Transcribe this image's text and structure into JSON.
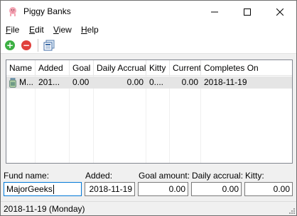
{
  "window": {
    "title": "Piggy Banks",
    "icon": "piggy-bank-icon",
    "controls": [
      "minimize-icon",
      "maximize-icon",
      "close-icon"
    ]
  },
  "menu": [
    {
      "label_first": "F",
      "label_rest": "ile"
    },
    {
      "label_first": "E",
      "label_rest": "dit"
    },
    {
      "label_first": "V",
      "label_rest": "iew"
    },
    {
      "label_first": "H",
      "label_rest": "elp"
    }
  ],
  "toolbar": {
    "add_icon": "add-icon",
    "remove_icon": "remove-icon",
    "report_icon": "report-icon",
    "add_color": "#3cb043",
    "remove_color": "#e0403c"
  },
  "list": {
    "columns": [
      "Name",
      "Added",
      "Goal",
      "Daily Accrual",
      "Kitty",
      "Current",
      "Completes On"
    ],
    "rows": [
      {
        "icon": "jar-icon",
        "name": "M...",
        "added": "201...",
        "goal": "0.00",
        "daily_accrual": "0.00",
        "kitty": "0....",
        "current": "0.00",
        "completes_on": "2018-11-19"
      }
    ]
  },
  "form": {
    "fund_name_label": "Fund name:",
    "fund_name_value": "MajorGeeks",
    "added_label": "Added:",
    "added_value": "2018-11-19",
    "goal_label": "Goal amount:",
    "goal_value": "0.00",
    "daily_label": "Daily accrual:",
    "daily_value": "0.00",
    "kitty_label": "Kitty:",
    "kitty_value": "0.00"
  },
  "status": {
    "text": "2018-11-19  (Monday)"
  }
}
